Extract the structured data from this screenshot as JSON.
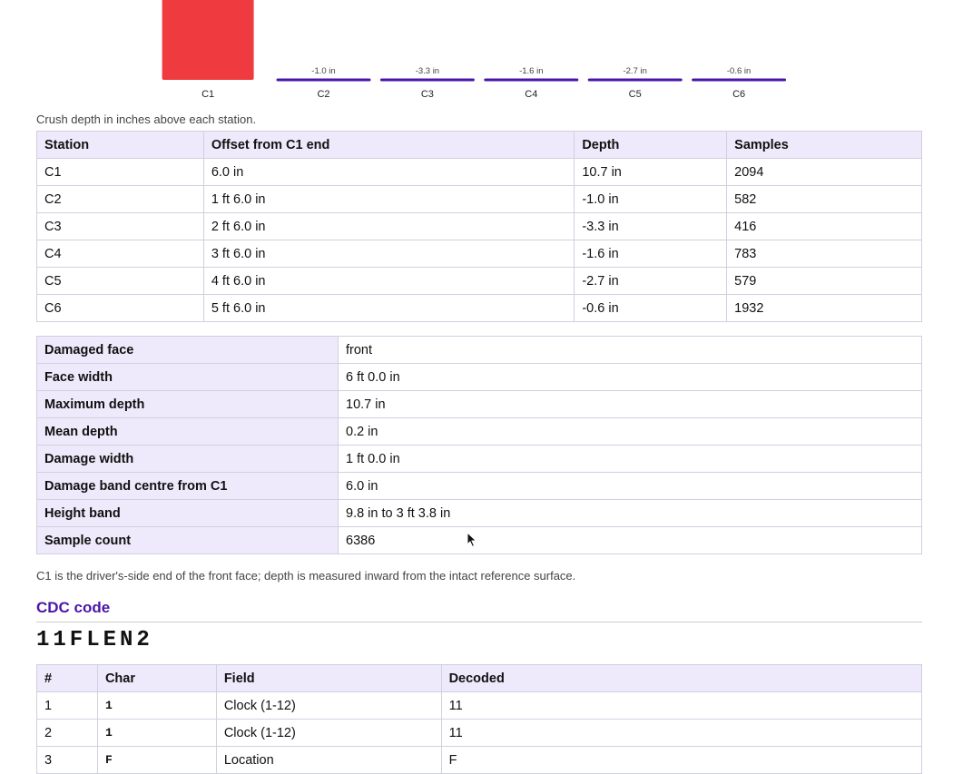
{
  "chart_data": {
    "type": "bar",
    "categories": [
      "C1",
      "C2",
      "C3",
      "C4",
      "C5",
      "C6"
    ],
    "values": [
      10.7,
      -1.0,
      -3.3,
      -1.6,
      -2.7,
      -0.6
    ],
    "value_labels": [
      "",
      "-1.0 in",
      "-3.3 in",
      "-1.6 in",
      "-2.7 in",
      "-0.6 in"
    ],
    "bar_colors": [
      "#ef3a3f",
      "#4a16a8",
      "#4a16a8",
      "#4a16a8",
      "#4a16a8",
      "#4a16a8"
    ],
    "unit": "in"
  },
  "chart_caption": "Crush depth in inches above each station.",
  "stations_table": {
    "headers": [
      "Station",
      "Offset from C1 end",
      "Depth",
      "Samples"
    ],
    "rows": [
      [
        "C1",
        "6.0 in",
        "10.7 in",
        "2094"
      ],
      [
        "C2",
        "1 ft 6.0 in",
        "-1.0 in",
        "582"
      ],
      [
        "C3",
        "2 ft 6.0 in",
        "-3.3 in",
        "416"
      ],
      [
        "C4",
        "3 ft 6.0 in",
        "-1.6 in",
        "783"
      ],
      [
        "C5",
        "4 ft 6.0 in",
        "-2.7 in",
        "579"
      ],
      [
        "C6",
        "5 ft 6.0 in",
        "-0.6 in",
        "1932"
      ]
    ]
  },
  "summary_table": {
    "rows": [
      [
        "Damaged face",
        "front"
      ],
      [
        "Face width",
        "6 ft 0.0 in"
      ],
      [
        "Maximum depth",
        "10.7 in"
      ],
      [
        "Mean depth",
        "0.2 in"
      ],
      [
        "Damage width",
        "1 ft 0.0 in"
      ],
      [
        "Damage band centre from C1",
        "6.0 in"
      ],
      [
        "Height band",
        "9.8 in to 3 ft 3.8 in"
      ],
      [
        "Sample count",
        "6386"
      ]
    ]
  },
  "summary_caption": "C1 is the driver's-side end of the front face; depth is measured inward from the intact reference surface.",
  "cdc": {
    "heading": "CDC code",
    "code": "11FLEN2",
    "table": {
      "headers": [
        "#",
        "Char",
        "Field",
        "Decoded"
      ],
      "rows": [
        [
          "1",
          "1",
          "Clock (1-12)",
          "11"
        ],
        [
          "2",
          "1",
          "Clock (1-12)",
          "11"
        ],
        [
          "3",
          "F",
          "Location",
          "F"
        ]
      ]
    }
  },
  "colors": {
    "accent": "#4a16a8",
    "max_bar": "#ef3a3f",
    "header_bg": "#efeafb"
  }
}
